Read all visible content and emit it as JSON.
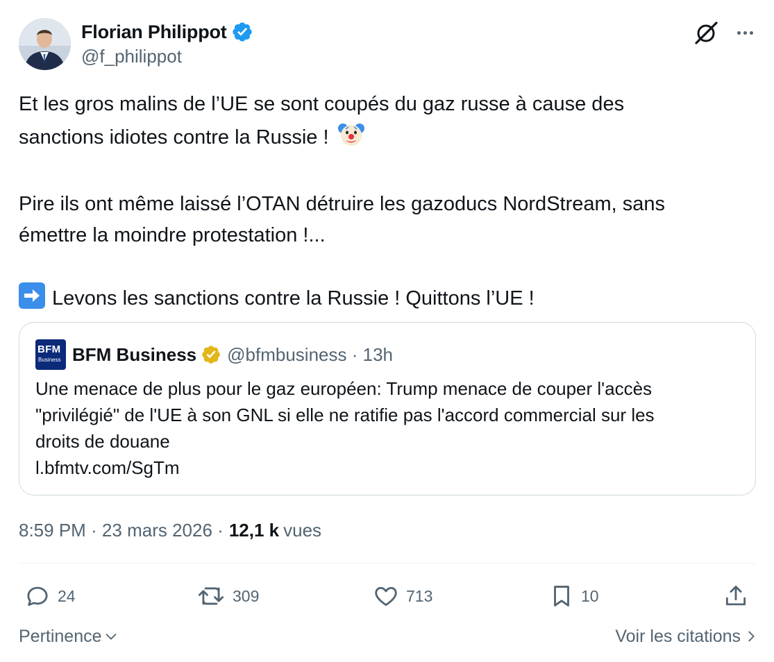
{
  "author": {
    "name": "Florian Philippot",
    "handle": "@f_philippot",
    "verified_color": "#1d9bf0"
  },
  "tweet": {
    "paragraph1_line1": "Et les gros malins de l’UE se sont coupés du gaz russe à cause des",
    "paragraph1_line2": "sanctions idiotes contre la Russie !",
    "paragraph1_emoji": "clown-face",
    "paragraph2_line1": "Pire ils ont même laissé l’OTAN détruire les gazoducs NordStream, sans",
    "paragraph2_line2": "émettre la moindre protestation !...",
    "paragraph3_emoji": "right-arrow",
    "paragraph3": "Levons les sanctions contre la Russie ! Quittons l’UE !"
  },
  "quoted": {
    "logo_text": "BFM",
    "logo_subtext": "Business",
    "name": "BFM Business",
    "handle_time": "@bfmbusiness · 13h",
    "badge_color": "#e2b719",
    "line1": "Une menace de plus pour le gaz européen: Trump menace de couper l'accès",
    "line2": "\"privilégié\" de l'UE à son GNL si elle ne ratifie pas l'accord commercial sur les",
    "line3": "droits de douane",
    "link": "l.bfmtv.com/SgTm"
  },
  "meta": {
    "time_date": "8:59 PM · 23 mars 2026 ·",
    "views_count": "12,1 k",
    "views_label": "vues"
  },
  "actions": {
    "replies": "24",
    "reposts": "309",
    "likes": "713",
    "bookmarks": "10"
  },
  "footer": {
    "sort_label": "Pertinence",
    "quotes_link": "Voir les citations"
  },
  "colors": {
    "text_primary": "#0f1419",
    "text_secondary": "#536471",
    "border": "#cfd9de"
  }
}
